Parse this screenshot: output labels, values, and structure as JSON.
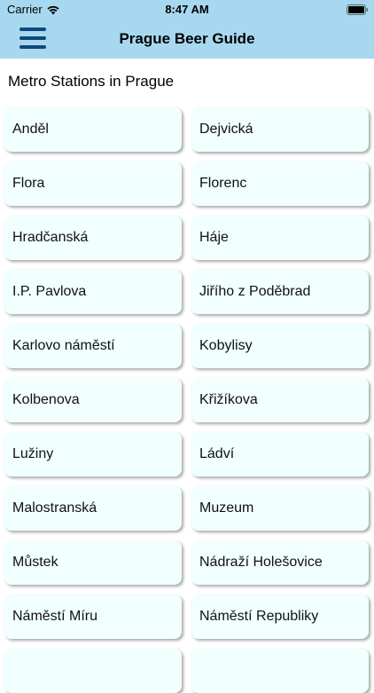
{
  "status_bar": {
    "carrier": "Carrier",
    "time": "8:47 AM",
    "icons": [
      "wifi-icon",
      "battery-icon"
    ]
  },
  "nav": {
    "title": "Prague Beer Guide",
    "menu_icon": "hamburger-menu-icon"
  },
  "section": {
    "title": "Metro Stations in Prague"
  },
  "stations": [
    "Anděl",
    "Dejvická",
    "Flora",
    "Florenc",
    "Hradčanská",
    "Háje",
    "I.P. Pavlova",
    "Jiřího z Poděbrad",
    "Karlovo náměstí",
    "Kobylisy",
    "Kolbenova",
    "Křižíkova",
    "Lužiny",
    "Ládví",
    "Malostranská",
    "Muzeum",
    "Můstek",
    "Nádraží Holešovice",
    "Náměstí Míru",
    "Náměstí Republiky",
    "",
    ""
  ],
  "colors": {
    "header_bg": "#a8d8ef",
    "menu_icon": "#0b4a7a",
    "card_bg": "#f1fffe"
  }
}
